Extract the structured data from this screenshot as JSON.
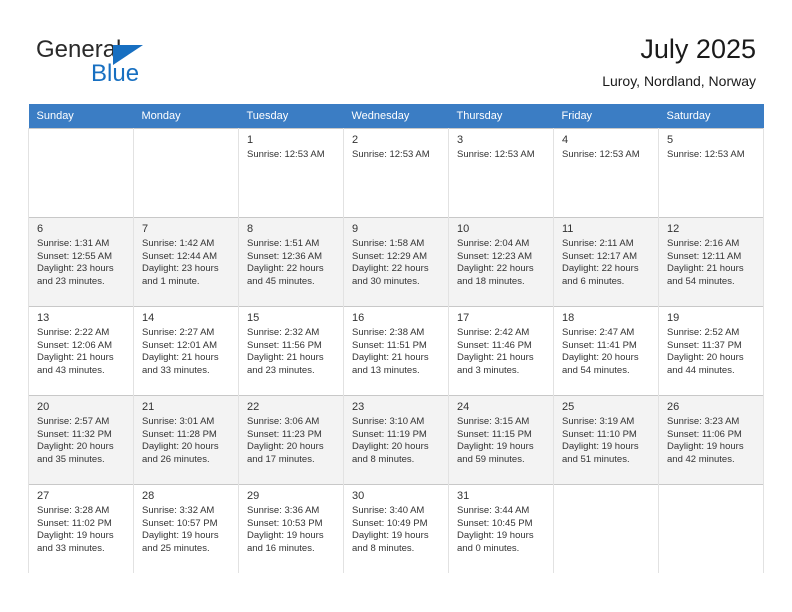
{
  "brand": {
    "name_part1": "General",
    "name_part2": "Blue",
    "logo_icon": "blue-triangle-icon",
    "accent_color": "#176fc1"
  },
  "header": {
    "title": "July 2025",
    "subtitle": "Luroy, Nordland, Norway"
  },
  "colors": {
    "header_row_bg": "#3b7dc4",
    "header_row_text": "#ffffff",
    "shaded_row_bg": "#f3f3f3",
    "cell_border": "#e2e2e2",
    "text": "#333333"
  },
  "weekdays": [
    "Sunday",
    "Monday",
    "Tuesday",
    "Wednesday",
    "Thursday",
    "Friday",
    "Saturday"
  ],
  "weeks": [
    {
      "shaded": false,
      "days": [
        {
          "empty": true
        },
        {
          "empty": true
        },
        {
          "empty": false,
          "num": "1",
          "sunrise": "Sunrise: 12:53 AM",
          "sunset": "",
          "daylight": ""
        },
        {
          "empty": false,
          "num": "2",
          "sunrise": "Sunrise: 12:53 AM",
          "sunset": "",
          "daylight": ""
        },
        {
          "empty": false,
          "num": "3",
          "sunrise": "Sunrise: 12:53 AM",
          "sunset": "",
          "daylight": ""
        },
        {
          "empty": false,
          "num": "4",
          "sunrise": "Sunrise: 12:53 AM",
          "sunset": "",
          "daylight": ""
        },
        {
          "empty": false,
          "num": "5",
          "sunrise": "Sunrise: 12:53 AM",
          "sunset": "",
          "daylight": ""
        }
      ]
    },
    {
      "shaded": true,
      "days": [
        {
          "empty": false,
          "num": "6",
          "sunrise": "Sunrise: 1:31 AM",
          "sunset": "Sunset: 12:55 AM",
          "daylight": "Daylight: 23 hours and 23 minutes."
        },
        {
          "empty": false,
          "num": "7",
          "sunrise": "Sunrise: 1:42 AM",
          "sunset": "Sunset: 12:44 AM",
          "daylight": "Daylight: 23 hours and 1 minute."
        },
        {
          "empty": false,
          "num": "8",
          "sunrise": "Sunrise: 1:51 AM",
          "sunset": "Sunset: 12:36 AM",
          "daylight": "Daylight: 22 hours and 45 minutes."
        },
        {
          "empty": false,
          "num": "9",
          "sunrise": "Sunrise: 1:58 AM",
          "sunset": "Sunset: 12:29 AM",
          "daylight": "Daylight: 22 hours and 30 minutes."
        },
        {
          "empty": false,
          "num": "10",
          "sunrise": "Sunrise: 2:04 AM",
          "sunset": "Sunset: 12:23 AM",
          "daylight": "Daylight: 22 hours and 18 minutes."
        },
        {
          "empty": false,
          "num": "11",
          "sunrise": "Sunrise: 2:11 AM",
          "sunset": "Sunset: 12:17 AM",
          "daylight": "Daylight: 22 hours and 6 minutes."
        },
        {
          "empty": false,
          "num": "12",
          "sunrise": "Sunrise: 2:16 AM",
          "sunset": "Sunset: 12:11 AM",
          "daylight": "Daylight: 21 hours and 54 minutes."
        }
      ]
    },
    {
      "shaded": false,
      "days": [
        {
          "empty": false,
          "num": "13",
          "sunrise": "Sunrise: 2:22 AM",
          "sunset": "Sunset: 12:06 AM",
          "daylight": "Daylight: 21 hours and 43 minutes."
        },
        {
          "empty": false,
          "num": "14",
          "sunrise": "Sunrise: 2:27 AM",
          "sunset": "Sunset: 12:01 AM",
          "daylight": "Daylight: 21 hours and 33 minutes."
        },
        {
          "empty": false,
          "num": "15",
          "sunrise": "Sunrise: 2:32 AM",
          "sunset": "Sunset: 11:56 PM",
          "daylight": "Daylight: 21 hours and 23 minutes."
        },
        {
          "empty": false,
          "num": "16",
          "sunrise": "Sunrise: 2:38 AM",
          "sunset": "Sunset: 11:51 PM",
          "daylight": "Daylight: 21 hours and 13 minutes."
        },
        {
          "empty": false,
          "num": "17",
          "sunrise": "Sunrise: 2:42 AM",
          "sunset": "Sunset: 11:46 PM",
          "daylight": "Daylight: 21 hours and 3 minutes."
        },
        {
          "empty": false,
          "num": "18",
          "sunrise": "Sunrise: 2:47 AM",
          "sunset": "Sunset: 11:41 PM",
          "daylight": "Daylight: 20 hours and 54 minutes."
        },
        {
          "empty": false,
          "num": "19",
          "sunrise": "Sunrise: 2:52 AM",
          "sunset": "Sunset: 11:37 PM",
          "daylight": "Daylight: 20 hours and 44 minutes."
        }
      ]
    },
    {
      "shaded": true,
      "days": [
        {
          "empty": false,
          "num": "20",
          "sunrise": "Sunrise: 2:57 AM",
          "sunset": "Sunset: 11:32 PM",
          "daylight": "Daylight: 20 hours and 35 minutes."
        },
        {
          "empty": false,
          "num": "21",
          "sunrise": "Sunrise: 3:01 AM",
          "sunset": "Sunset: 11:28 PM",
          "daylight": "Daylight: 20 hours and 26 minutes."
        },
        {
          "empty": false,
          "num": "22",
          "sunrise": "Sunrise: 3:06 AM",
          "sunset": "Sunset: 11:23 PM",
          "daylight": "Daylight: 20 hours and 17 minutes."
        },
        {
          "empty": false,
          "num": "23",
          "sunrise": "Sunrise: 3:10 AM",
          "sunset": "Sunset: 11:19 PM",
          "daylight": "Daylight: 20 hours and 8 minutes."
        },
        {
          "empty": false,
          "num": "24",
          "sunrise": "Sunrise: 3:15 AM",
          "sunset": "Sunset: 11:15 PM",
          "daylight": "Daylight: 19 hours and 59 minutes."
        },
        {
          "empty": false,
          "num": "25",
          "sunrise": "Sunrise: 3:19 AM",
          "sunset": "Sunset: 11:10 PM",
          "daylight": "Daylight: 19 hours and 51 minutes."
        },
        {
          "empty": false,
          "num": "26",
          "sunrise": "Sunrise: 3:23 AM",
          "sunset": "Sunset: 11:06 PM",
          "daylight": "Daylight: 19 hours and 42 minutes."
        }
      ]
    },
    {
      "shaded": false,
      "days": [
        {
          "empty": false,
          "num": "27",
          "sunrise": "Sunrise: 3:28 AM",
          "sunset": "Sunset: 11:02 PM",
          "daylight": "Daylight: 19 hours and 33 minutes."
        },
        {
          "empty": false,
          "num": "28",
          "sunrise": "Sunrise: 3:32 AM",
          "sunset": "Sunset: 10:57 PM",
          "daylight": "Daylight: 19 hours and 25 minutes."
        },
        {
          "empty": false,
          "num": "29",
          "sunrise": "Sunrise: 3:36 AM",
          "sunset": "Sunset: 10:53 PM",
          "daylight": "Daylight: 19 hours and 16 minutes."
        },
        {
          "empty": false,
          "num": "30",
          "sunrise": "Sunrise: 3:40 AM",
          "sunset": "Sunset: 10:49 PM",
          "daylight": "Daylight: 19 hours and 8 minutes."
        },
        {
          "empty": false,
          "num": "31",
          "sunrise": "Sunrise: 3:44 AM",
          "sunset": "Sunset: 10:45 PM",
          "daylight": "Daylight: 19 hours and 0 minutes."
        },
        {
          "empty": true
        },
        {
          "empty": true
        }
      ]
    }
  ]
}
